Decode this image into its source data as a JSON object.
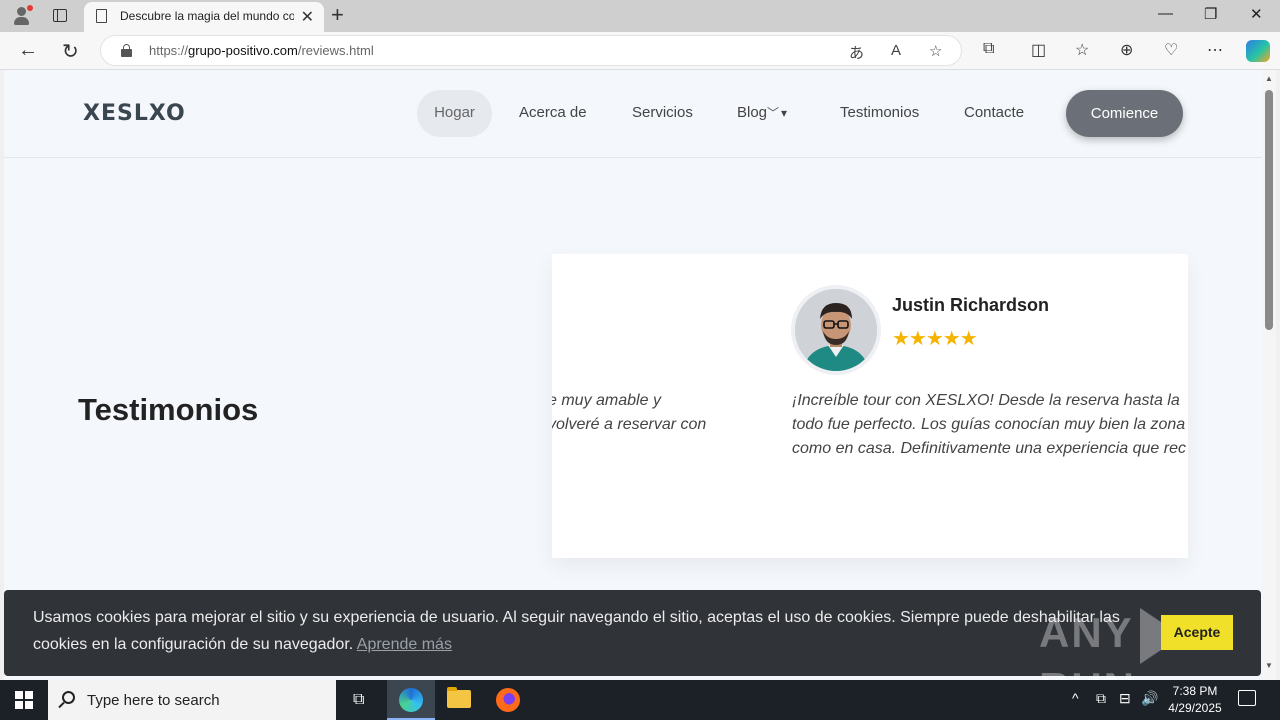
{
  "browser": {
    "tab_title": "Descubre la magia del mundo co",
    "tab_close": "✕",
    "new_tab": "+",
    "url_prefix": "https://",
    "url_domain": "grupo-positivo.com",
    "url_path": "/reviews.html",
    "window": {
      "minimize": "—",
      "restore": "❐",
      "close": "✕"
    },
    "nav": {
      "back": "←",
      "reload": "↻"
    },
    "url_icons": {
      "translate": "あ",
      "read_aloud": "A",
      "favorite": "☆"
    },
    "toolbar_icons": {
      "extensions": "⧉",
      "split": "◫",
      "favorites": "☆",
      "collections": "⊕",
      "performance": "♡",
      "more": "⋯"
    }
  },
  "site": {
    "logo": "XESLXO",
    "menu": [
      "Hogar",
      "Acerca de",
      "Servicios",
      "Blog",
      "Testimonios",
      "Contacte"
    ],
    "blog_caret": "▾",
    "cta": "Comience"
  },
  "testimonials": {
    "section_title": "Testimonios",
    "previous_review_lines": [
      "e muy amable y",
      "volveré a reservar con"
    ],
    "reviewer": "Justin Richardson",
    "rating": 5,
    "stars": "★★★★★",
    "review_lines": [
      "¡Increíble tour con XESLXO! Desde la reserva hasta la",
      "todo fue perfecto. Los guías conocían muy bien la zona y",
      "como en casa. Definitivamente una experiencia que rec"
    ]
  },
  "cookie": {
    "line1": "Usamos cookies para mejorar el sitio y su experiencia de usuario. Al seguir navegando el sitio, aceptas el uso de cookies. Siempre puede deshabilitar las",
    "line2": "cookies en la configuración de su navegador.",
    "learn_more": "Aprende más",
    "accept": "Acepte"
  },
  "watermark": {
    "left": "ANY",
    "right": "RUN"
  },
  "taskbar": {
    "search_placeholder": "Type here to search",
    "time": "7:38 PM",
    "date": "4/29/2025",
    "tray_icons": [
      "^",
      "⧉",
      "⊟",
      "🔊"
    ]
  }
}
